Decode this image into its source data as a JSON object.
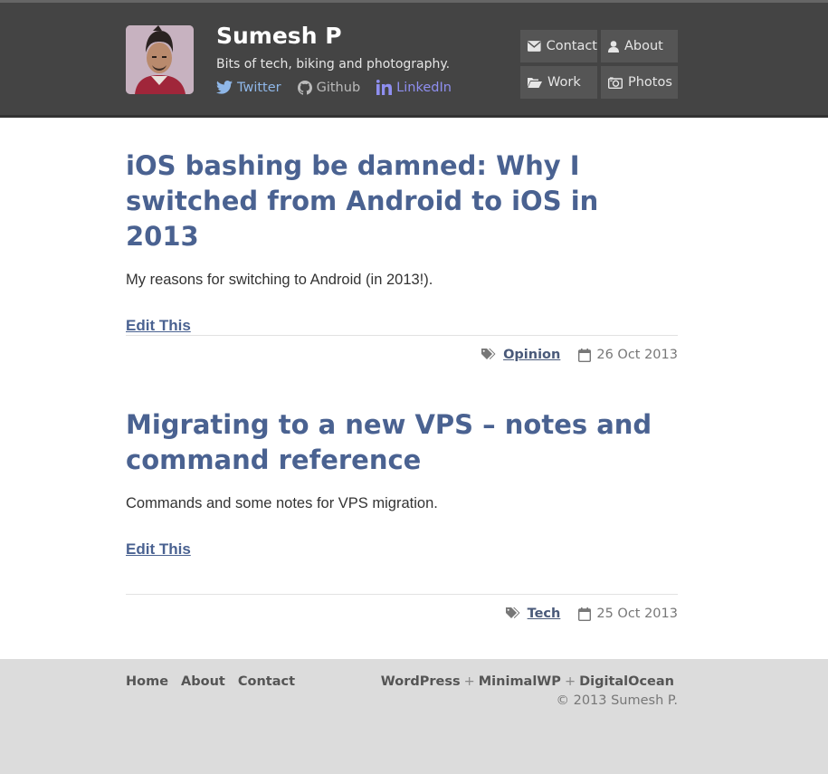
{
  "site": {
    "title": "Sumesh P",
    "tagline": "Bits of tech, biking and photography.",
    "social": [
      {
        "label": "Twitter",
        "icon": "twitter-icon"
      },
      {
        "label": "Github",
        "icon": "github-icon"
      },
      {
        "label": "LinkedIn",
        "icon": "linkedin-icon"
      }
    ]
  },
  "nav": {
    "contact": "Contact",
    "about": "About",
    "work": "Work",
    "photos": "Photos"
  },
  "posts": [
    {
      "title": "iOS bashing be damned: Why I switched from Android to iOS in 2013",
      "excerpt": "My reasons for switching to Android (in 2013!).",
      "edit": "Edit This",
      "category": "Opinion",
      "date": "26 Oct 2013"
    },
    {
      "title": "Migrating to a new VPS – notes and command reference",
      "excerpt": "Commands and some notes for VPS migration.",
      "edit": "Edit This",
      "category": "Tech",
      "date": "25 Oct 2013"
    }
  ],
  "footer": {
    "nav": [
      "Home",
      "About",
      "Contact"
    ],
    "credits": [
      "WordPress",
      "MinimalWP",
      "DigitalOcean"
    ],
    "plus": "+",
    "copyright": "© 2013 Sumesh P."
  },
  "colors": {
    "header_bg": "#444444",
    "nav_button_bg": "#555555",
    "link_blue": "#4a6291",
    "footer_bg": "#dcdcdc"
  }
}
